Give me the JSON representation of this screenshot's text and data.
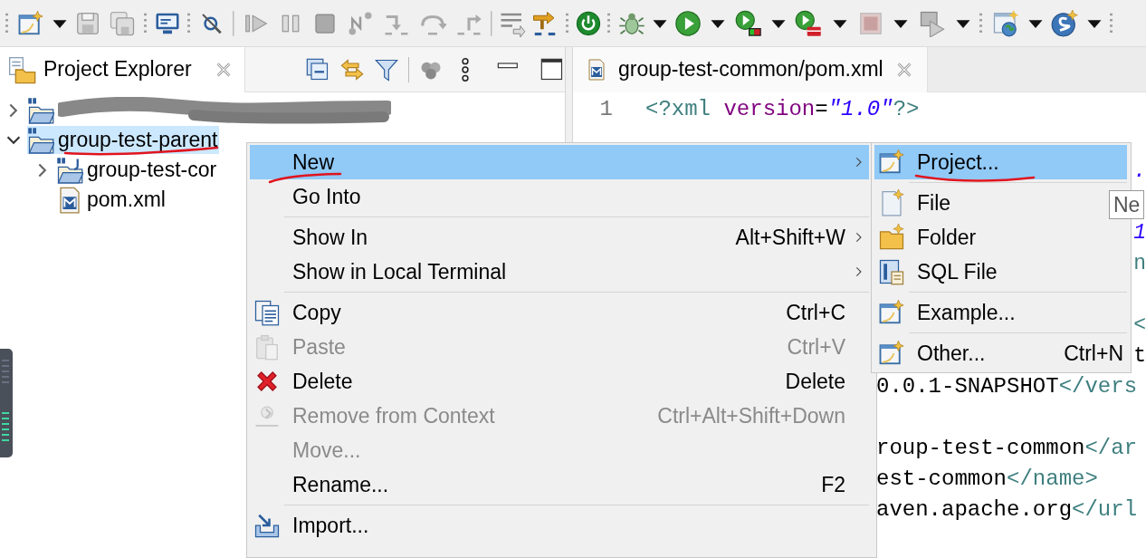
{
  "explorer": {
    "title": "Project Explorer",
    "tree": [
      {
        "kind": "redacted",
        "expanded": false,
        "selected": false
      },
      {
        "kind": "project",
        "label": "group-test-parent",
        "expanded": true,
        "selected": true,
        "children": [
          {
            "kind": "module",
            "label": "group-test-cor",
            "expanded": false,
            "selected": false
          },
          {
            "kind": "file",
            "label": "pom.xml",
            "selected": false
          }
        ]
      }
    ]
  },
  "editor": {
    "tab": {
      "title": "group-test-common/pom.xml"
    },
    "lines": [
      {
        "kind": "full",
        "number": "1",
        "segments": [
          {
            "kind": "tag",
            "text": "<?xml "
          },
          {
            "kind": "attr",
            "text": "version"
          },
          {
            "kind": "plain",
            "text": "="
          },
          {
            "kind": "string",
            "text": "\"1.0\""
          },
          {
            "kind": "tag",
            "text": "?>"
          }
        ]
      },
      {
        "kind": "hidden"
      },
      {
        "kind": "tail",
        "segments": [
          {
            "kind": "string",
            "text": "."
          }
        ]
      },
      {
        "kind": "hidden"
      },
      {
        "kind": "tail",
        "segments": [
          {
            "kind": "string",
            "text": "1"
          }
        ]
      },
      {
        "kind": "tail",
        "segments": [
          {
            "kind": "tag",
            "text": "n"
          }
        ]
      },
      {
        "kind": "hidden"
      },
      {
        "kind": "tail",
        "segments": [
          {
            "kind": "tag",
            "text": "<"
          }
        ]
      },
      {
        "kind": "tail",
        "segments": [
          {
            "kind": "plain",
            "text": "t"
          }
        ]
      },
      {
        "kind": "clipped",
        "segments": [
          {
            "kind": "plain",
            "text": "0.0.1-SNAPSHOT"
          },
          {
            "kind": "tag",
            "text": "</vers"
          }
        ]
      },
      {
        "kind": "hidden"
      },
      {
        "kind": "clipped",
        "segments": [
          {
            "kind": "plain",
            "text": "roup-test-common"
          },
          {
            "kind": "tag",
            "text": "</ar"
          }
        ]
      },
      {
        "kind": "clipped",
        "segments": [
          {
            "kind": "plain",
            "text": "est-common"
          },
          {
            "kind": "tag",
            "text": "</name>"
          }
        ]
      },
      {
        "kind": "clipped",
        "segments": [
          {
            "kind": "plain",
            "text": "aven.apache.org"
          },
          {
            "kind": "tag",
            "text": "</url"
          }
        ]
      }
    ]
  },
  "context_menu": {
    "items": [
      {
        "kind": "plain",
        "label": "New",
        "has_submenu": true,
        "disabled": false,
        "selected": true
      },
      {
        "kind": "plain",
        "label": "Go Into",
        "has_submenu": false,
        "disabled": false,
        "selected": false
      },
      {
        "kind": "separator"
      },
      {
        "kind": "plain",
        "label": "Show In",
        "shortcut": "Alt+Shift+W",
        "has_submenu": true,
        "disabled": false,
        "selected": false
      },
      {
        "kind": "plain",
        "label": "Show in Local Terminal",
        "has_submenu": true,
        "disabled": false,
        "selected": false
      },
      {
        "kind": "separator"
      },
      {
        "kind": "copy",
        "label": "Copy",
        "shortcut": "Ctrl+C",
        "has_submenu": false,
        "disabled": false,
        "selected": false
      },
      {
        "kind": "paste",
        "label": "Paste",
        "shortcut": "Ctrl+V",
        "has_submenu": false,
        "disabled": true,
        "selected": false
      },
      {
        "kind": "delete",
        "label": "Delete",
        "shortcut": "Delete",
        "has_submenu": false,
        "disabled": false,
        "selected": false
      },
      {
        "kind": "remove",
        "label": "Remove from Context",
        "shortcut": "Ctrl+Alt+Shift+Down",
        "has_submenu": false,
        "disabled": true,
        "selected": false
      },
      {
        "kind": "plain",
        "label": "Move...",
        "has_submenu": false,
        "disabled": true,
        "selected": false
      },
      {
        "kind": "plain",
        "label": "Rename...",
        "shortcut": "F2",
        "has_submenu": false,
        "disabled": false,
        "selected": false
      },
      {
        "kind": "separator"
      },
      {
        "kind": "import",
        "label": "Import...",
        "has_submenu": false,
        "disabled": false,
        "selected": false
      }
    ]
  },
  "submenu": {
    "items": [
      {
        "kind": "wizard",
        "label": "Project...",
        "selected": true
      },
      {
        "kind": "separator"
      },
      {
        "kind": "file",
        "label": "File",
        "selected": false
      },
      {
        "kind": "folder",
        "label": "Folder",
        "selected": false
      },
      {
        "kind": "sql",
        "label": "SQL File",
        "selected": false
      },
      {
        "kind": "separator"
      },
      {
        "kind": "wizard",
        "label": "Example...",
        "selected": false
      },
      {
        "kind": "separator"
      },
      {
        "kind": "wizard",
        "label": "Other...",
        "shortcut": "Ctrl+N",
        "selected": false
      }
    ]
  },
  "tooltip": {
    "text": "Ne"
  }
}
